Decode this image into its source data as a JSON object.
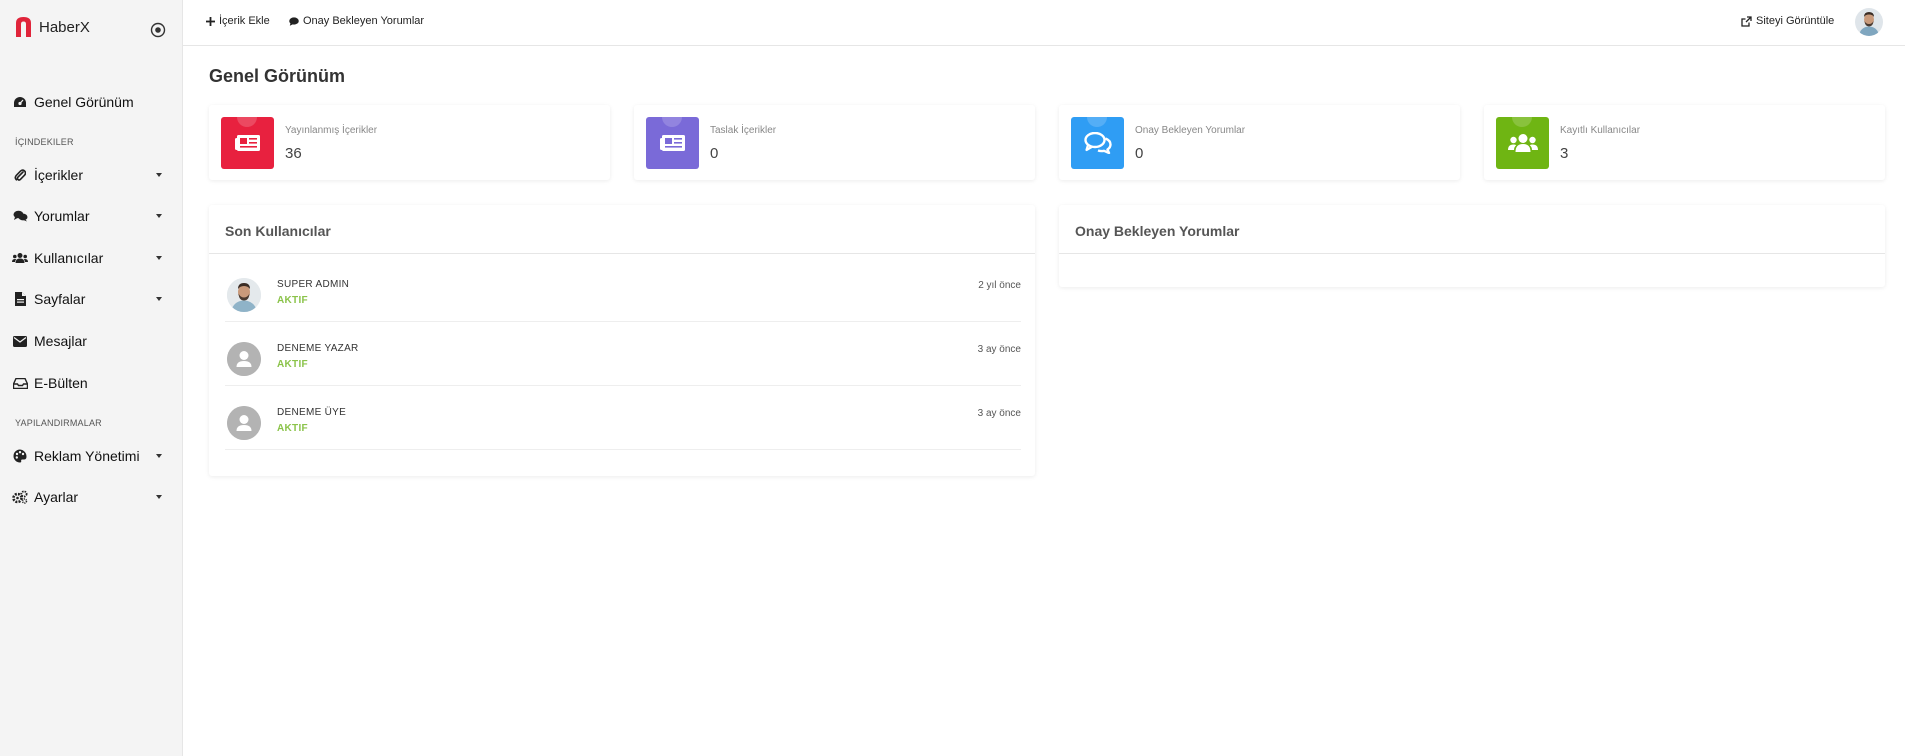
{
  "brand": {
    "name": "HaberX",
    "logo_color": "#e0243a"
  },
  "sidebar": {
    "items": [
      {
        "label": "Genel Görünüm",
        "icon": "dashboard-icon",
        "caret": false
      },
      {
        "label": "İçerikler",
        "icon": "paperclip-icon",
        "caret": true
      },
      {
        "label": "Yorumlar",
        "icon": "comments-icon",
        "caret": true
      },
      {
        "label": "Kullanıcılar",
        "icon": "users-icon",
        "caret": true
      },
      {
        "label": "Sayfalar",
        "icon": "file-icon",
        "caret": true
      },
      {
        "label": "Mesajlar",
        "icon": "envelope-icon",
        "caret": false
      },
      {
        "label": "E-Bülten",
        "icon": "inbox-icon",
        "caret": false
      },
      {
        "label": "Reklam Yönetimi",
        "icon": "palette-icon",
        "caret": true
      },
      {
        "label": "Ayarlar",
        "icon": "cogs-icon",
        "caret": true
      }
    ],
    "headings": [
      "İÇINDEKILER",
      "YAPILANDIRMALAR"
    ]
  },
  "topbar": {
    "add_content": "İçerik Ekle",
    "pending_comments": "Onay Bekleyen Yorumlar",
    "view_site": "Siteyi Görüntüle"
  },
  "main": {
    "title": "Genel Görünüm",
    "stats": [
      {
        "label": "Yayınlanmış İçerikler",
        "value": "36",
        "color": "#e8213f",
        "icon": "newspaper-icon"
      },
      {
        "label": "Taslak İçerikler",
        "value": "0",
        "color": "#7a6ad8",
        "icon": "newspaper-icon"
      },
      {
        "label": "Onay Bekleyen Yorumlar",
        "value": "0",
        "color": "#2f9df4",
        "icon": "comments-icon"
      },
      {
        "label": "Kayıtlı Kullanıcılar",
        "value": "3",
        "color": "#6fb513",
        "icon": "users-icon"
      }
    ],
    "recent_users": {
      "title": "Son Kullanıcılar",
      "rows": [
        {
          "name": "SUPER ADMIN",
          "status": "AKTIF",
          "time": "2 yıl önce",
          "avatar": "photo"
        },
        {
          "name": "DENEME YAZAR",
          "status": "AKTIF",
          "time": "3 ay önce",
          "avatar": "default"
        },
        {
          "name": "DENEME ÜYE",
          "status": "AKTIF",
          "time": "3 ay önce",
          "avatar": "default"
        }
      ]
    },
    "pending_panel": {
      "title": "Onay Bekleyen Yorumlar"
    }
  }
}
